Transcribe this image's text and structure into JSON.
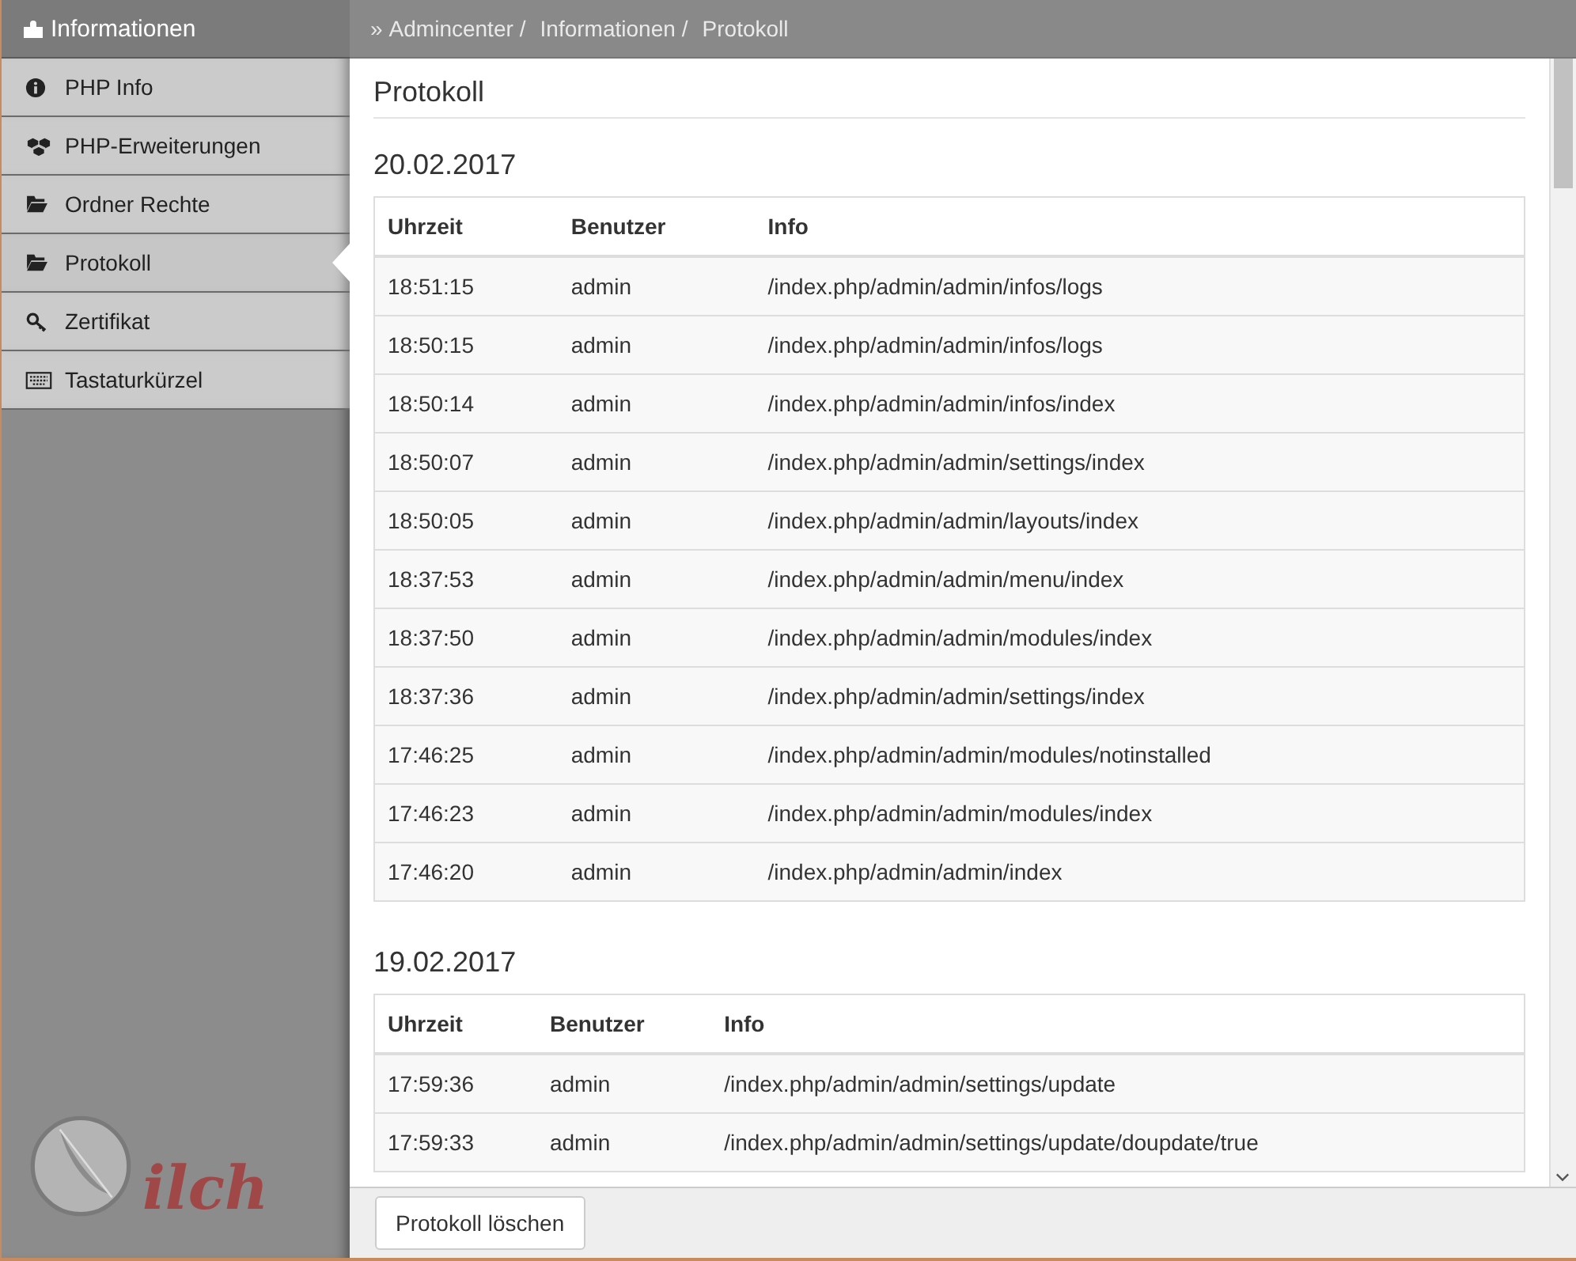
{
  "sidebar": {
    "title": "Informationen",
    "items": [
      {
        "label": "PHP Info",
        "selected": false
      },
      {
        "label": "PHP-Erweiterungen",
        "selected": false
      },
      {
        "label": "Ordner Rechte",
        "selected": false
      },
      {
        "label": "Protokoll",
        "selected": true
      },
      {
        "label": "Zertifikat",
        "selected": false
      },
      {
        "label": "Tastaturkürzel",
        "selected": false
      }
    ],
    "logo": "ilch"
  },
  "breadcrumb": {
    "prefix": "»",
    "separator": "/",
    "items": [
      "Admincenter",
      "Informationen",
      "Protokoll"
    ]
  },
  "page_title": "Protokoll",
  "days": [
    {
      "date": "20.02.2017",
      "columns": [
        "Uhrzeit",
        "Benutzer",
        "Info"
      ],
      "rows": [
        [
          "18:51:15",
          "admin",
          "/index.php/admin/admin/infos/logs"
        ],
        [
          "18:50:15",
          "admin",
          "/index.php/admin/admin/infos/logs"
        ],
        [
          "18:50:14",
          "admin",
          "/index.php/admin/admin/infos/index"
        ],
        [
          "18:50:07",
          "admin",
          "/index.php/admin/admin/settings/index"
        ],
        [
          "18:50:05",
          "admin",
          "/index.php/admin/admin/layouts/index"
        ],
        [
          "18:37:53",
          "admin",
          "/index.php/admin/admin/menu/index"
        ],
        [
          "18:37:50",
          "admin",
          "/index.php/admin/admin/modules/index"
        ],
        [
          "18:37:36",
          "admin",
          "/index.php/admin/admin/settings/index"
        ],
        [
          "17:46:25",
          "admin",
          "/index.php/admin/admin/modules/notinstalled"
        ],
        [
          "17:46:23",
          "admin",
          "/index.php/admin/admin/modules/index"
        ],
        [
          "17:46:20",
          "admin",
          "/index.php/admin/admin/index"
        ]
      ]
    },
    {
      "date": "19.02.2017",
      "columns": [
        "Uhrzeit",
        "Benutzer",
        "Info"
      ],
      "rows": [
        [
          "17:59:36",
          "admin",
          "/index.php/admin/admin/settings/update"
        ],
        [
          "17:59:33",
          "admin",
          "/index.php/admin/admin/settings/update/doupdate/true"
        ]
      ]
    }
  ],
  "footer": {
    "button": "Protokoll löschen"
  }
}
